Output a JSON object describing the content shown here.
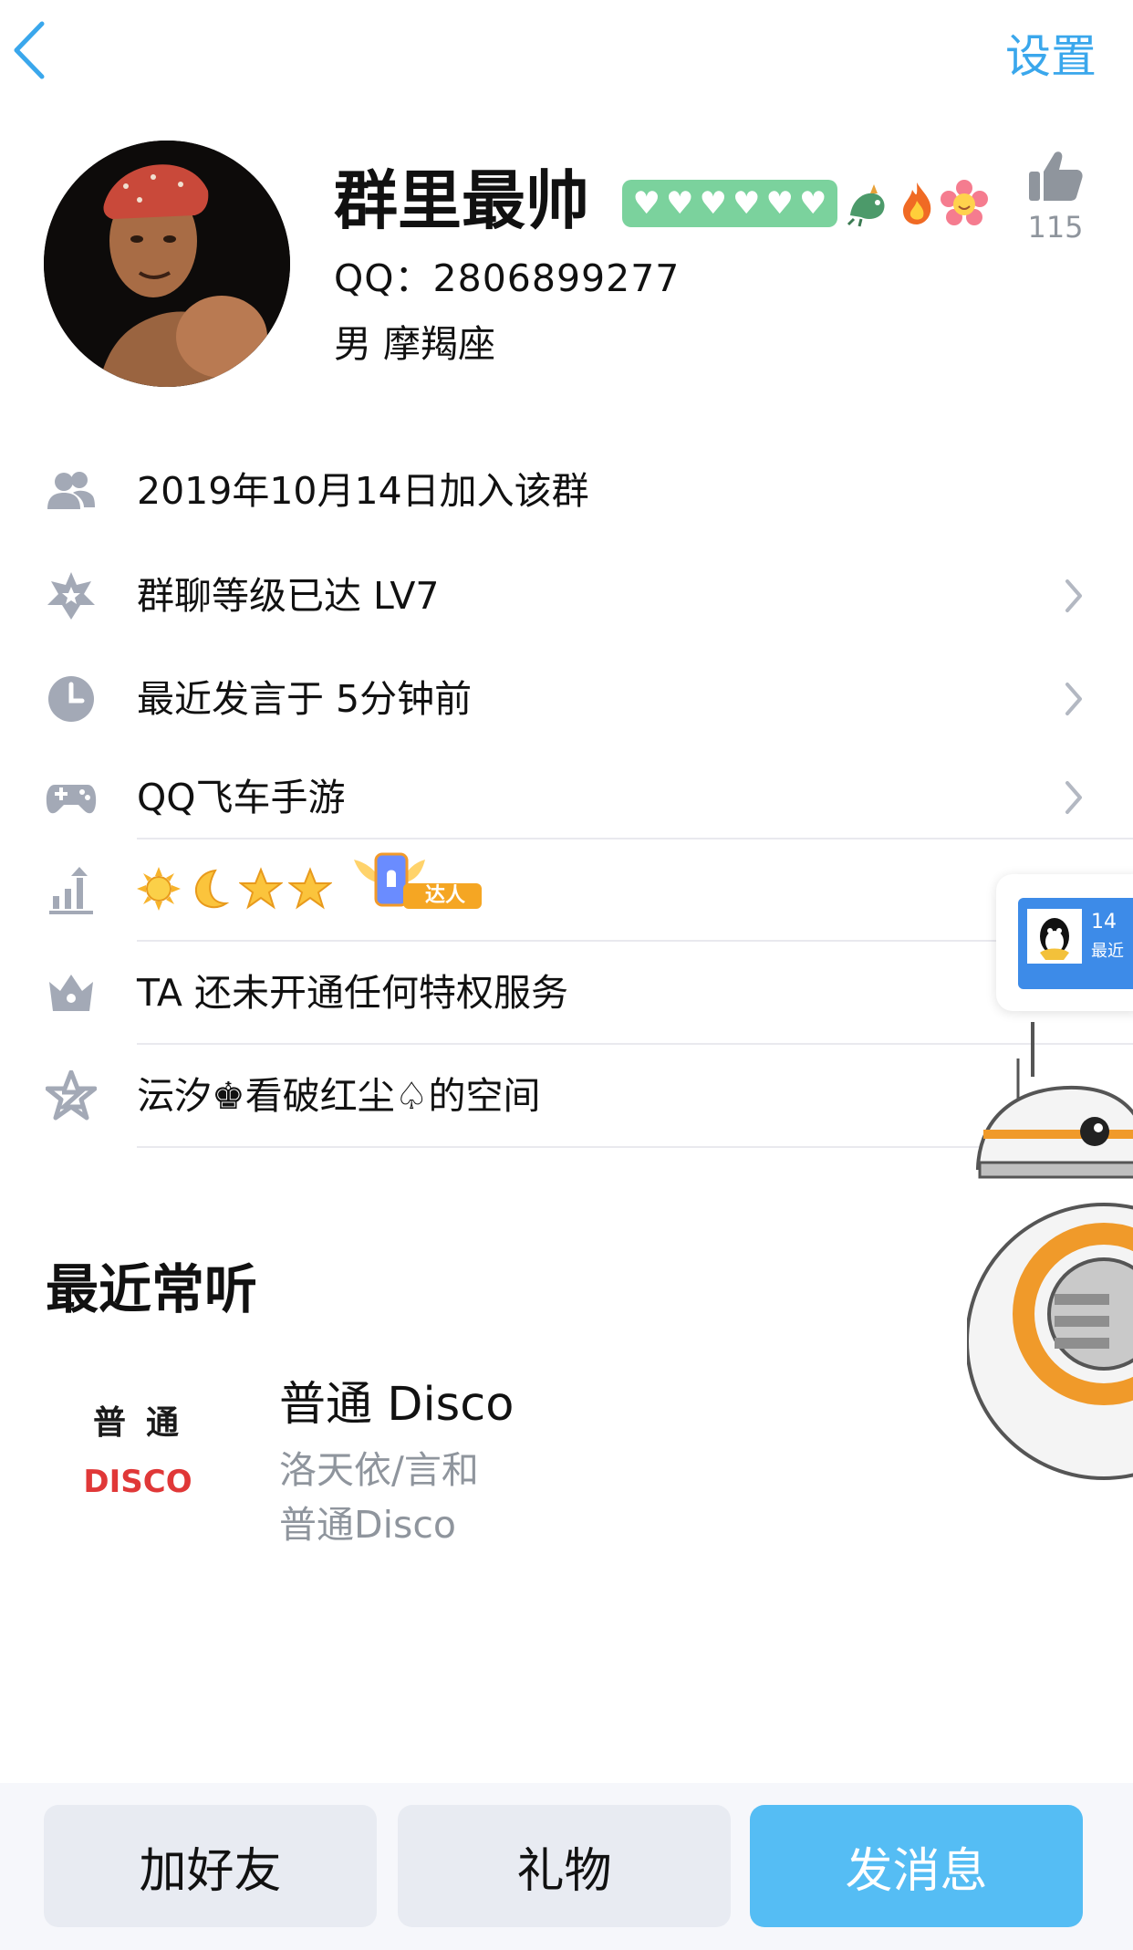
{
  "header": {
    "back_icon": "chevron-left-icon",
    "settings_label": "设置"
  },
  "profile": {
    "nickname": "群里最帅",
    "level_hearts": [
      "♥",
      "♥",
      "♥",
      "♥",
      "♥",
      "♥"
    ],
    "level_badge_color": "#7bd29d",
    "decorations": [
      "dragon-icon",
      "fire-icon",
      "flower-icon"
    ],
    "qq_line": "QQ：2806899277",
    "gender_line": "男  摩羯座",
    "like_icon": "thumbs-up-icon",
    "like_count": "115"
  },
  "info_rows": [
    {
      "icon": "group-members-icon",
      "text": "2019年10月14日加入该群",
      "has_chevron": false
    },
    {
      "icon": "star-badge-icon",
      "text": "群聊等级已达 LV7",
      "has_chevron": true
    },
    {
      "icon": "clock-icon",
      "text": "最近发言于 5分钟前",
      "has_chevron": true
    },
    {
      "icon": "gamepad-icon",
      "text": "QQ飞车手游",
      "has_chevron": true
    },
    {
      "icon": "level-chart-icon",
      "text": "",
      "has_chevron": false,
      "level_icons": [
        "sun-icon",
        "moon-icon",
        "star-icon",
        "star-icon"
      ],
      "talent_badge_label": "达人"
    },
    {
      "icon": "crown-icon",
      "text": "TA 还未开通任何特权服务",
      "has_chevron": false
    },
    {
      "icon": "qzone-star-icon",
      "text": "沄汐♚看破红尘♤的空间",
      "has_chevron": false
    }
  ],
  "floating_card": {
    "number": "14",
    "subtext": "最近"
  },
  "recent": {
    "title": "最近常听",
    "cover_line1": "普通",
    "cover_line2": "DISCO",
    "song_title": "普通 Disco",
    "artist": "洛天依/言和",
    "album": "普通Disco"
  },
  "actions": {
    "add_friend": "加好友",
    "gift": "礼物",
    "send_message": "发消息"
  },
  "colors": {
    "accent": "#3aa7ec",
    "message_button": "#55bdf4",
    "secondary_button": "#e8ebf2",
    "muted_text": "#8f959d"
  }
}
